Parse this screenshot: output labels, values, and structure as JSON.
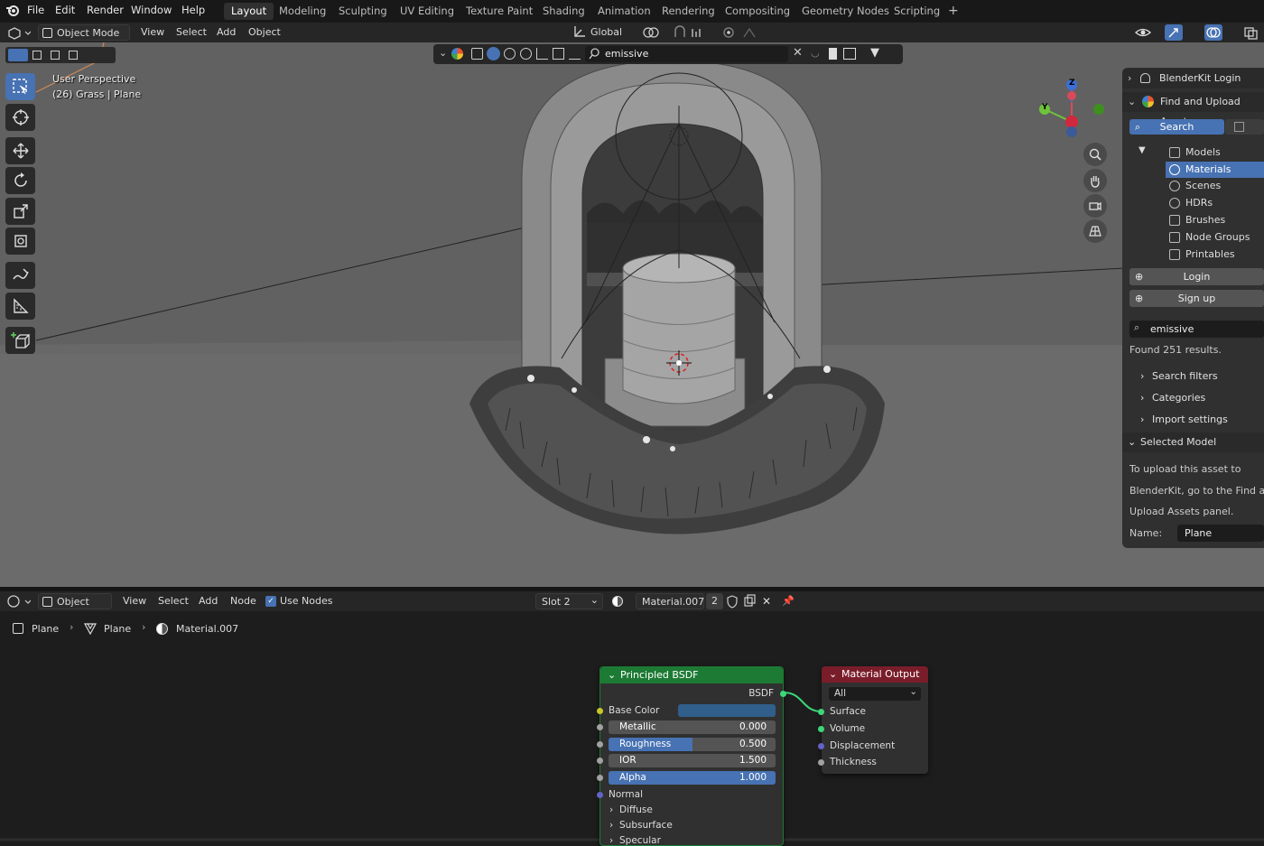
{
  "top_menu": [
    "File",
    "Edit",
    "Render",
    "Window",
    "Help"
  ],
  "workspaces": [
    "Layout",
    "Modeling",
    "Sculpting",
    "UV Editing",
    "Texture Paint",
    "Shading",
    "Animation",
    "Rendering",
    "Compositing",
    "Geometry Nodes",
    "Scripting"
  ],
  "workspace_add": "+",
  "viewport_header": {
    "mode": "Object Mode",
    "menus": [
      "View",
      "Select",
      "Add",
      "Object"
    ],
    "orientation": "Global"
  },
  "viewport_overlay": {
    "line1": "User Perspective",
    "line2": "(26) Grass | Plane"
  },
  "filter_search": {
    "value": "emissive"
  },
  "gizmo": {
    "z": "Z",
    "y": "Y"
  },
  "blenderkit": {
    "login_header": "BlenderKit Login",
    "find_header": "Find and Upload Assets",
    "search_tab": "Search",
    "categories": [
      "Models",
      "Materials",
      "Scenes",
      "HDRs",
      "Brushes",
      "Node Groups",
      "Printables"
    ],
    "selected_category": "Materials",
    "login_btn": "Login",
    "signup_btn": "Sign up",
    "search_value": "emissive",
    "results": "Found 251 results.",
    "search_filters": "Search filters",
    "categories_label": "Categories",
    "import_settings": "Import settings",
    "selected_model": "Selected Model",
    "upload_text": [
      "To upload this asset to",
      "BlenderKit, go to the Find and",
      "Upload Assets panel."
    ],
    "name_label": "Name:",
    "name_value": "Plane"
  },
  "node_header": {
    "mode": "Object",
    "menus": [
      "View",
      "Select",
      "Add",
      "Node"
    ],
    "use_nodes": "Use Nodes",
    "slot": "Slot 2",
    "material": "Material.007",
    "users": "2"
  },
  "breadcrumb": [
    "Plane",
    "Plane",
    "Material.007"
  ],
  "bsdf_node": {
    "title": "Principled BSDF",
    "output": "BSDF",
    "base_color": "Base Color",
    "base_color_hex": "#2f5f8a",
    "metallic": {
      "label": "Metallic",
      "value": "0.000",
      "fraction": 0
    },
    "roughness": {
      "label": "Roughness",
      "value": "0.500",
      "fraction": 0.5
    },
    "ior": {
      "label": "IOR",
      "value": "1.500",
      "fraction": 0
    },
    "alpha": {
      "label": "Alpha",
      "value": "1.000",
      "fraction": 1
    },
    "normal": "Normal",
    "sections": [
      "Diffuse",
      "Subsurface",
      "Specular"
    ]
  },
  "output_node": {
    "title": "Material Output",
    "target": "All",
    "inputs": [
      "Surface",
      "Volume",
      "Displacement",
      "Thickness"
    ]
  },
  "colors": {
    "accent": "#4772b3",
    "bsdf_header": "#1d7a34",
    "output_header": "#7a1d2a"
  }
}
